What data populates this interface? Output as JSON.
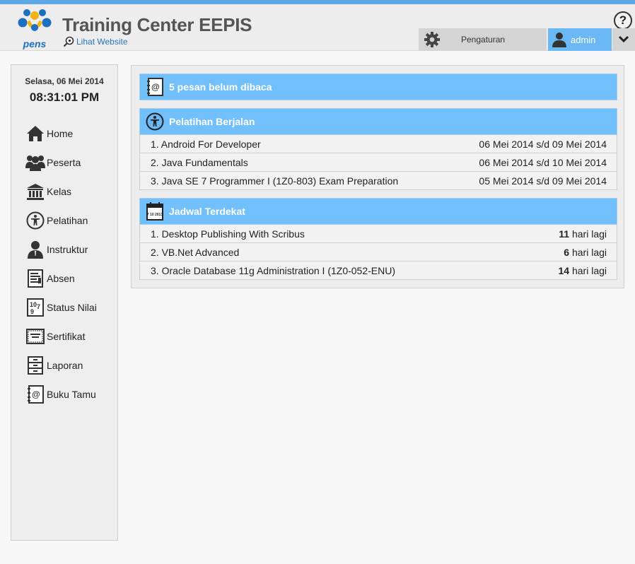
{
  "header": {
    "logo_text": "pens",
    "title": "Training Center EEPIS",
    "website_link": "Lihat Website",
    "help_label": "?",
    "settings_label": "Pengaturan",
    "user_label": "admin"
  },
  "sidebar": {
    "date": "Selasa, 06 Mei 2014",
    "time": "08:31:01 PM",
    "items": [
      {
        "label": "Home",
        "icon": "home-icon"
      },
      {
        "label": "Peserta",
        "icon": "users-icon"
      },
      {
        "label": "Kelas",
        "icon": "building-icon"
      },
      {
        "label": "Pelatihan",
        "icon": "accessibility-icon"
      },
      {
        "label": "Instruktur",
        "icon": "person-icon"
      },
      {
        "label": "Absen",
        "icon": "document-list-icon"
      },
      {
        "label": "Status Nilai",
        "icon": "grade-icon"
      },
      {
        "label": "Sertifikat",
        "icon": "certificate-icon"
      },
      {
        "label": "Laporan",
        "icon": "cabinet-icon"
      },
      {
        "label": "Buku Tamu",
        "icon": "address-book-icon"
      }
    ]
  },
  "messages": {
    "title": "5 pesan belum dibaca"
  },
  "ongoing": {
    "title": "Pelatihan Berjalan",
    "rows": [
      {
        "name": "1. Android For Developer",
        "date": "06 Mei 2014 s/d 09 Mei 2014"
      },
      {
        "name": "2. Java Fundamentals",
        "date": "06 Mei 2014 s/d 10 Mei 2014"
      },
      {
        "name": "3. Java SE 7 Programmer I (1Z0-803) Exam Preparation",
        "date": "05 Mei 2014 s/d 09 Mei 2014"
      }
    ]
  },
  "schedule": {
    "title": "Jadwal Terdekat",
    "calendar_icon_text": "7 10 2013",
    "suffix": "hari lagi",
    "rows": [
      {
        "name": "1. Desktop Publishing With Scribus",
        "days": "11"
      },
      {
        "name": "2. VB.Net Advanced",
        "days": "6"
      },
      {
        "name": "3. Oracle Database 11g Administration I (1Z0-052-ENU)",
        "days": "14"
      }
    ]
  },
  "colors": {
    "accent": "#72c0fb",
    "user_button": "#6ab8f4",
    "top_line": "#5ea8e8",
    "link": "#2a73c0"
  }
}
